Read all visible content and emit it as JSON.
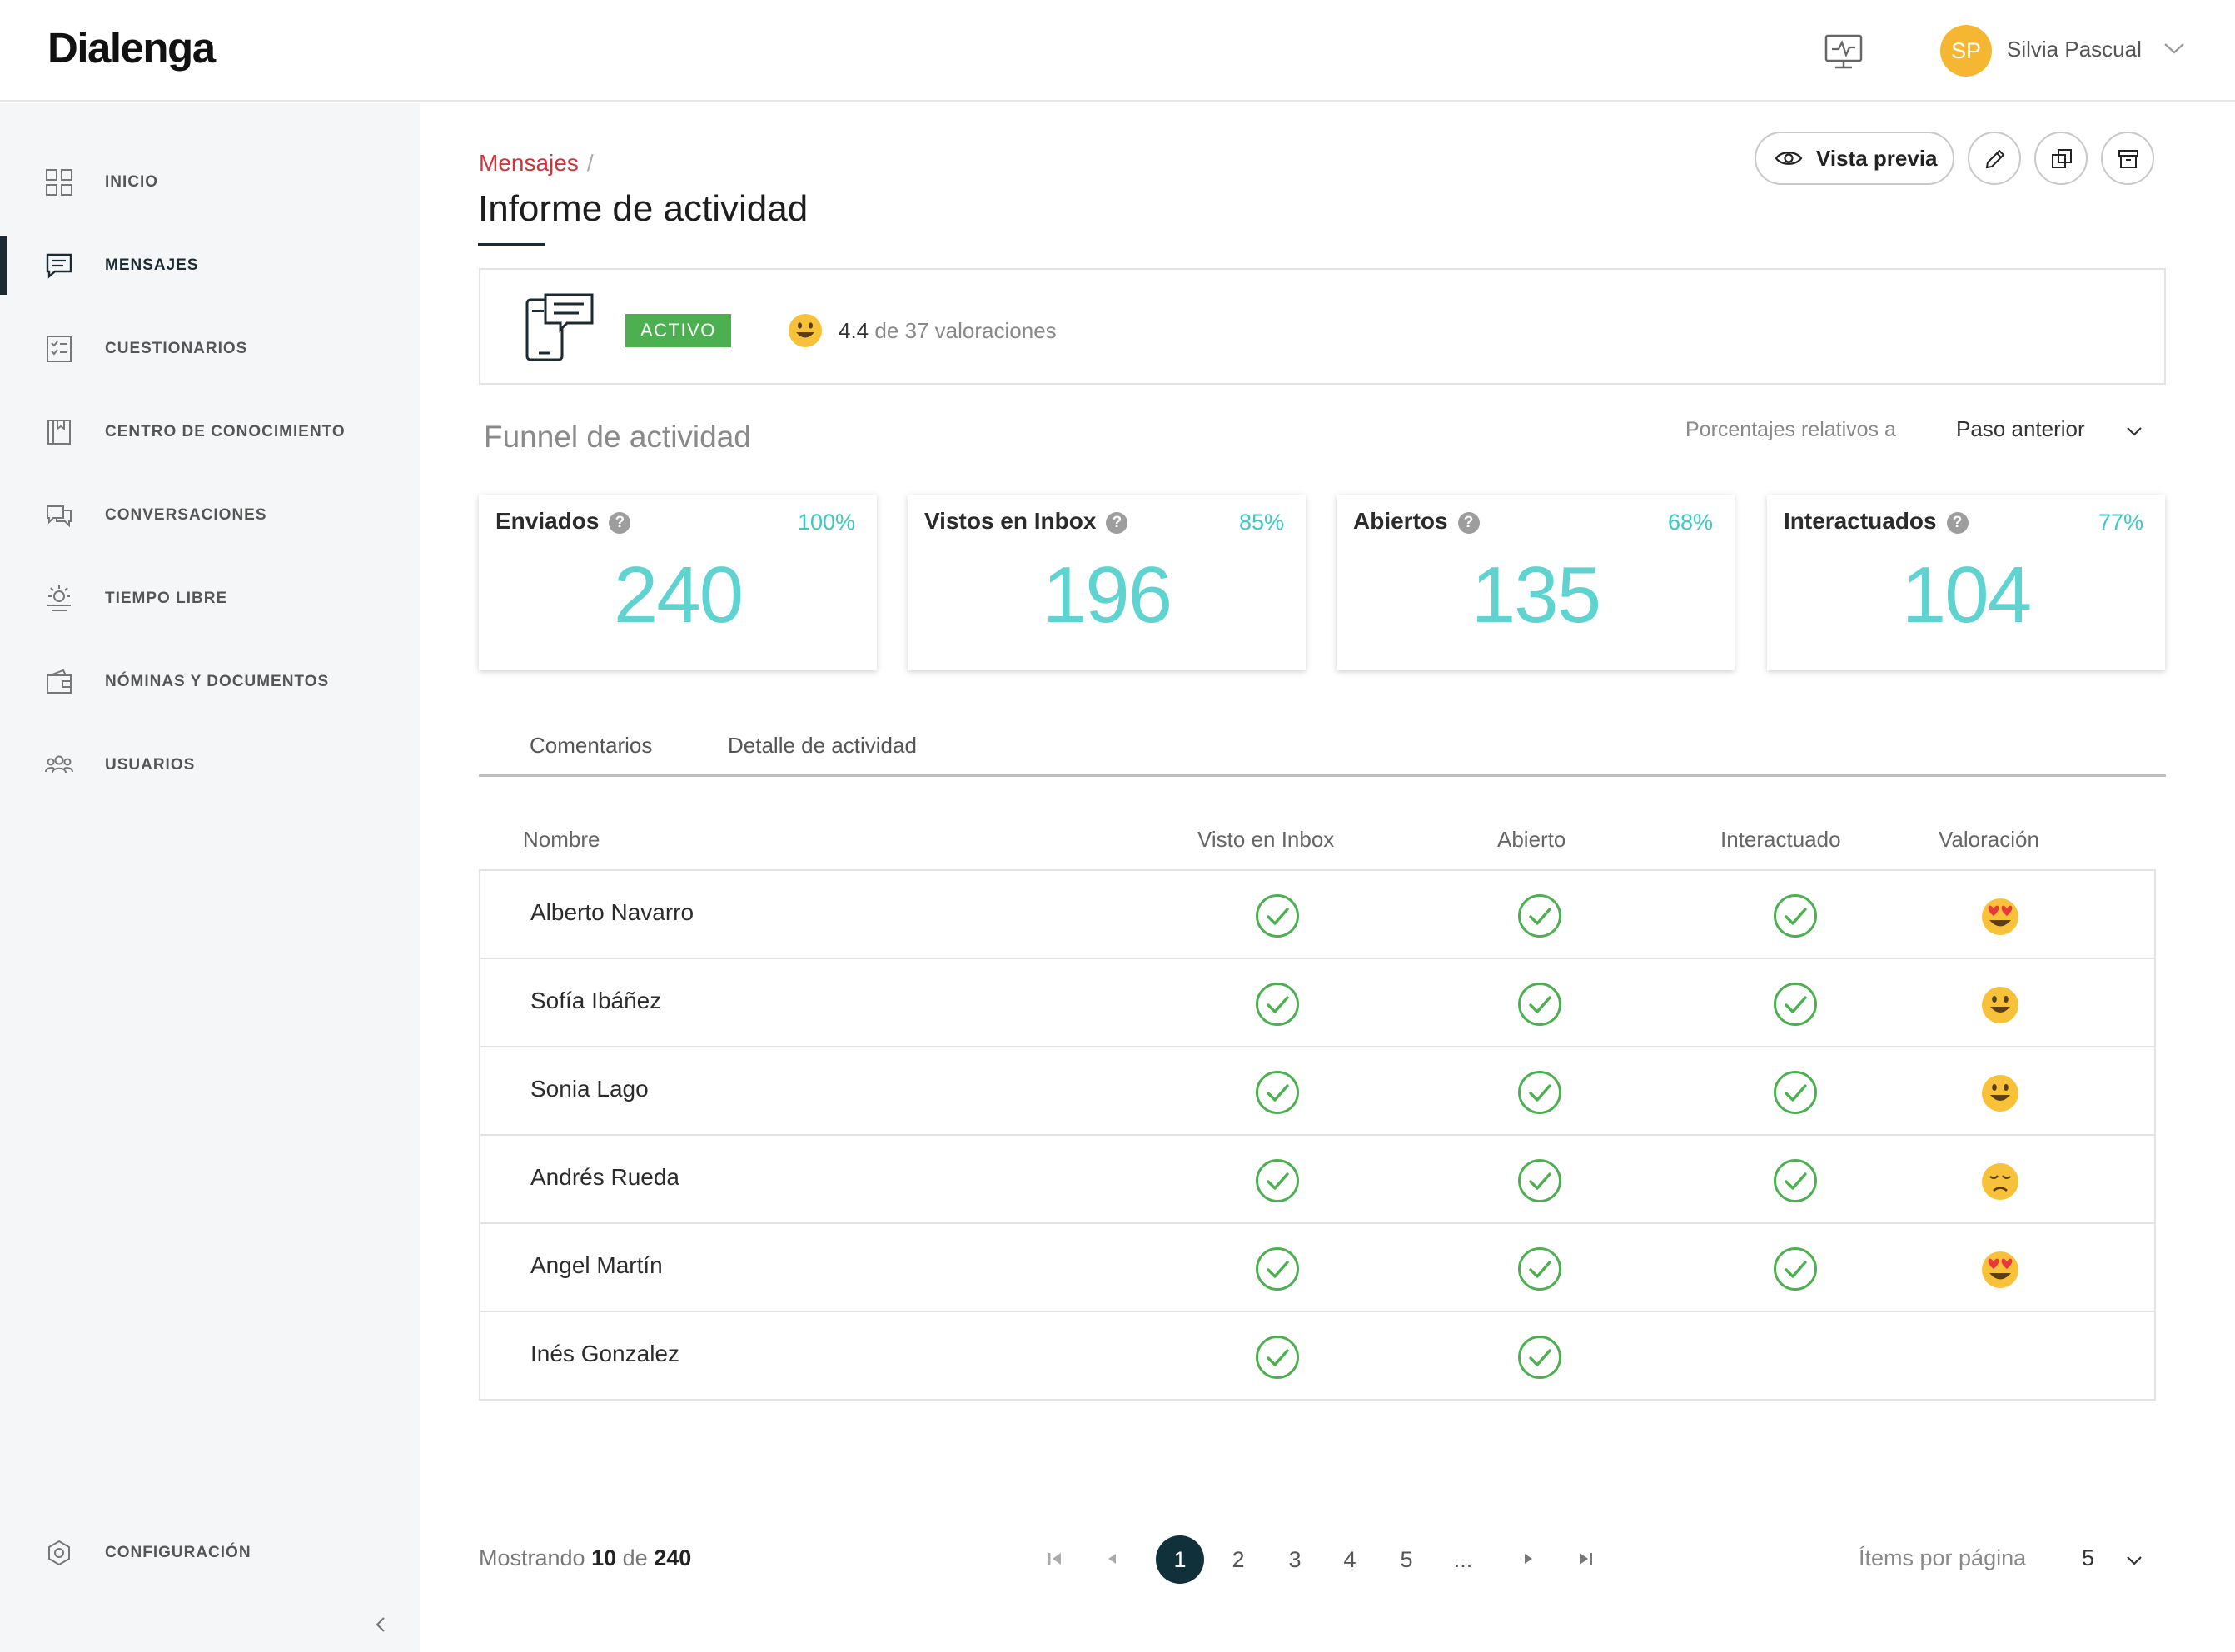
{
  "app": {
    "logo": "Dialenga"
  },
  "user": {
    "initials": "SP",
    "name": "Silvia Pascual",
    "avatar_color": "#f5b731"
  },
  "sidebar": {
    "items": [
      {
        "label": "INICIO",
        "icon": "grid-icon"
      },
      {
        "label": "MENSAJES",
        "icon": "message-icon",
        "active": true
      },
      {
        "label": "CUESTIONARIOS",
        "icon": "checklist-icon"
      },
      {
        "label": "CENTRO DE CONOCIMIENTO",
        "icon": "book-icon"
      },
      {
        "label": "CONVERSACIONES",
        "icon": "chat-bubbles-icon"
      },
      {
        "label": "TIEMPO LIBRE",
        "icon": "sun-icon"
      },
      {
        "label": "NÓMINAS Y DOCUMENTOS",
        "icon": "wallet-icon"
      },
      {
        "label": "USUARIOS",
        "icon": "users-icon"
      }
    ],
    "config_label": "CONFIGURACIÓN"
  },
  "breadcrumb": {
    "parent": "Mensajes",
    "separator": "/"
  },
  "page": {
    "title": "Informe de actividad"
  },
  "actions": {
    "preview_label": "Vista previa"
  },
  "status": {
    "badge": "ACTIVO",
    "rating_avg": "4.4",
    "rating_rest": "de 37 valoraciones",
    "badge_color": "#4caf50"
  },
  "funnel": {
    "title": "Funnel de actividad",
    "relative_label": "Porcentajes relativos a",
    "relative_value": "Paso anterior",
    "cards": [
      {
        "label": "Enviados",
        "help": "?",
        "percent": "100%",
        "value": "240"
      },
      {
        "label": "Vistos en Inbox",
        "help": "?",
        "percent": "85%",
        "value": "196"
      },
      {
        "label": "Abiertos",
        "help": "?",
        "percent": "68%",
        "value": "135"
      },
      {
        "label": "Interactuados",
        "help": "?",
        "percent": "77%",
        "value": "104"
      }
    ],
    "accent_color": "#5fd3d0"
  },
  "tabs": [
    "Comentarios",
    "Detalle de actividad"
  ],
  "table": {
    "columns": [
      "Nombre",
      "Visto en Inbox",
      "Abierto",
      "Interactuado",
      "Valoración"
    ],
    "rows": [
      {
        "name": "Alberto Navarro",
        "seen": true,
        "opened": true,
        "interacted": true,
        "rating": "heart-eyes"
      },
      {
        "name": "Sofía Ibáñez",
        "seen": true,
        "opened": true,
        "interacted": true,
        "rating": "smile"
      },
      {
        "name": "Sonia Lago",
        "seen": true,
        "opened": true,
        "interacted": true,
        "rating": "smile"
      },
      {
        "name": "Andrés Rueda",
        "seen": true,
        "opened": true,
        "interacted": true,
        "rating": "sad"
      },
      {
        "name": "Angel Martín",
        "seen": true,
        "opened": true,
        "interacted": true,
        "rating": "heart-eyes"
      },
      {
        "name": "Inés Gonzalez",
        "seen": true,
        "opened": true,
        "interacted": false,
        "rating": ""
      }
    ],
    "check_color": "#4caf50"
  },
  "pagination": {
    "showing_prefix": "Mostrando",
    "showing_count": "10",
    "showing_mid": "de",
    "showing_total": "240",
    "pages": [
      "1",
      "2",
      "3",
      "4",
      "5",
      "..."
    ],
    "current_page": "1",
    "items_label": "Ítems por página",
    "items_value": "5"
  }
}
